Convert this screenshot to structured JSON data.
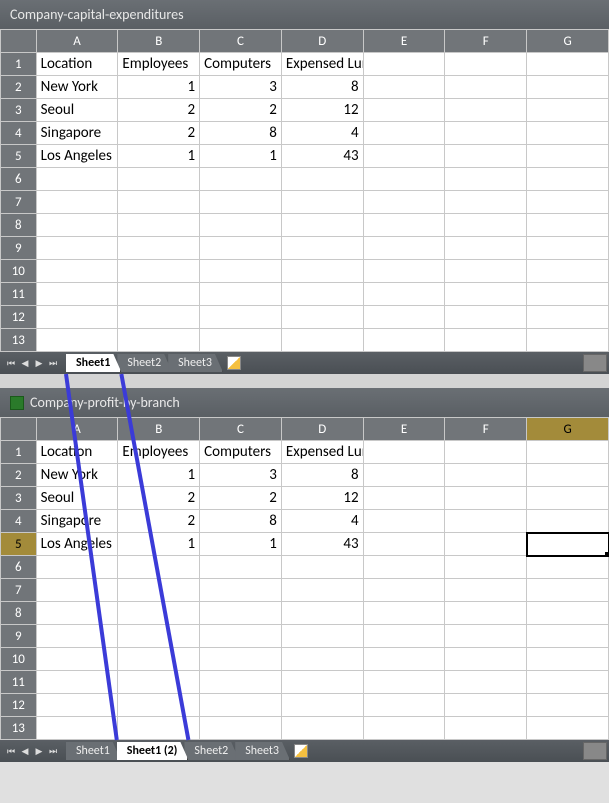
{
  "workbooks": [
    {
      "title": "Company-capital-expenditures",
      "show_icon": false,
      "headers": [
        "Location",
        "Employees",
        "Computers",
        "Expensed Lunches"
      ],
      "columns_shown": [
        "A",
        "B",
        "C",
        "D",
        "E",
        "F",
        "G"
      ],
      "rows_shown": 13,
      "rows": [
        {
          "Location": "New York",
          "Employees": 1,
          "Computers": 3,
          "Expensed Lunches": 8
        },
        {
          "Location": "Seoul",
          "Employees": 2,
          "Computers": 2,
          "Expensed Lunches": 12
        },
        {
          "Location": "Singapore",
          "Employees": 2,
          "Computers": 8,
          "Expensed Lunches": 4
        },
        {
          "Location": "Los Angeles",
          "Employees": 1,
          "Computers": 1,
          "Expensed Lunches": 43
        }
      ],
      "tabs": [
        "Sheet1",
        "Sheet2",
        "Sheet3"
      ],
      "active_tab": 0,
      "highlight_tab": 0,
      "selected_col": null,
      "selected_row": null,
      "active_cell": null
    },
    {
      "title": "Company-profit-by-branch",
      "show_icon": true,
      "headers": [
        "Location",
        "Employees",
        "Computers",
        "Expensed Lunches"
      ],
      "columns_shown": [
        "A",
        "B",
        "C",
        "D",
        "E",
        "F",
        "G"
      ],
      "rows_shown": 13,
      "rows": [
        {
          "Location": "New York",
          "Employees": 1,
          "Computers": 3,
          "Expensed Lunches": 8
        },
        {
          "Location": "Seoul",
          "Employees": 2,
          "Computers": 2,
          "Expensed Lunches": 12
        },
        {
          "Location": "Singapore",
          "Employees": 2,
          "Computers": 8,
          "Expensed Lunches": 4
        },
        {
          "Location": "Los Angeles",
          "Employees": 1,
          "Computers": 1,
          "Expensed Lunches": 43
        }
      ],
      "tabs": [
        "Sheet1",
        "Sheet1 (2)",
        "Sheet2",
        "Sheet3"
      ],
      "active_tab": 1,
      "highlight_tab": 1,
      "selected_col": "G",
      "selected_row": 5,
      "active_cell": {
        "col": "G",
        "row": 5
      }
    }
  ],
  "annotation": {
    "color": "#3b3bd8",
    "from_workbook": 0,
    "from_tab": 0,
    "to_workbook": 1,
    "to_tab": 1
  }
}
